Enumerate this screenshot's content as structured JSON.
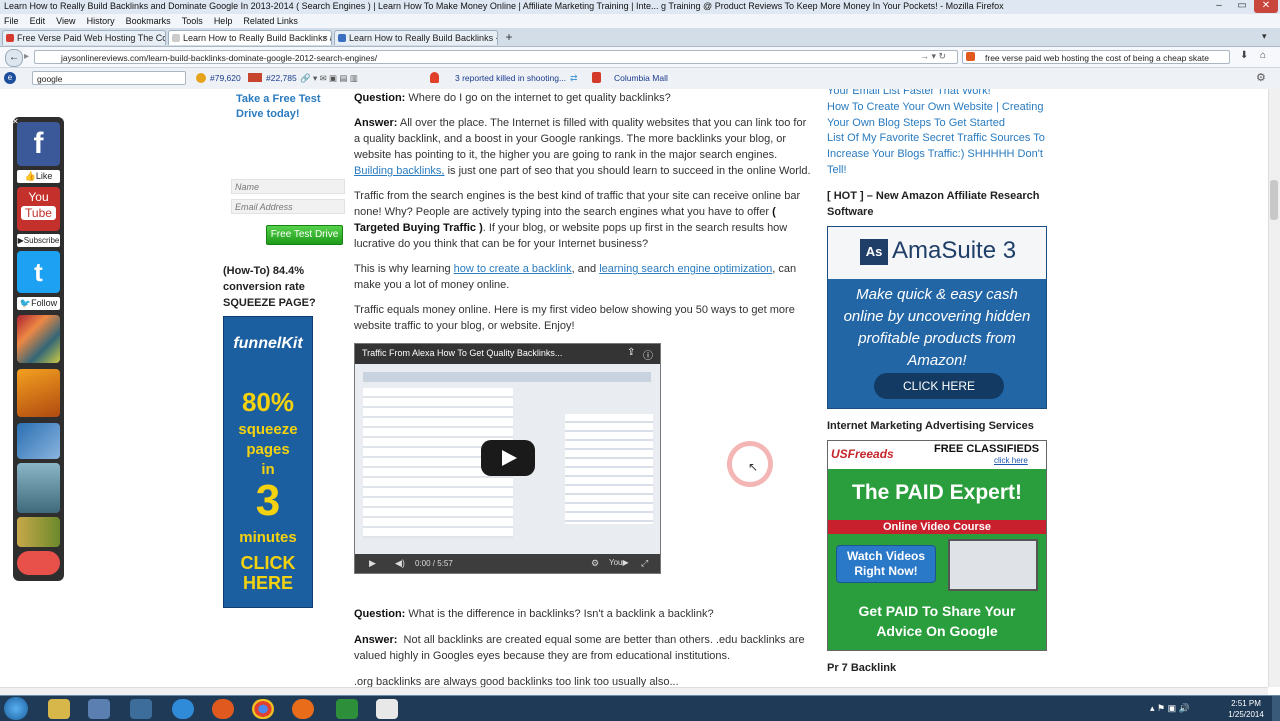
{
  "window": {
    "title": "Learn How to Really Build Backlinks and Dominate Google In 2013-2014 ( Search Engines ) | Learn How To Make Money Online | Affiliate Marketing Training | Inte... g Training @ Product Reviews To Keep More Money In Your Pockets! - Mozilla Firefox"
  },
  "menu": [
    "File",
    "Edit",
    "View",
    "History",
    "Bookmarks",
    "Tools",
    "Help",
    "Related Links"
  ],
  "tabs": [
    {
      "label": "Free Verse Paid Web Hosting The Cos...",
      "active": false
    },
    {
      "label": "Learn How to Really Build Backlinks a...",
      "active": true
    },
    {
      "label": "Learn How to Really Build Backlinks - ...",
      "active": false
    }
  ],
  "nav": {
    "url": "jaysonlinereviews.com/learn-build-backlinks-dominate-google-2012-search-engines/",
    "search": "free verse paid web hosting the cost of being a cheap skate"
  },
  "toolbar": {
    "search_value": "google",
    "alexa_rank": "#79,620",
    "us_rank": "#22,785",
    "news": "3 reported killed in shooting...",
    "mall": "Columbia Mall"
  },
  "left_sidebar": {
    "cta": "Take a Free Test Drive today!",
    "name_placeholder": "Name",
    "email_placeholder": "Email Address",
    "button": "Free Test Drive",
    "squeeze_title": "(How-To) 84.4% conversion rate SQUEEZE PAGE?",
    "funnelkit": {
      "brand": "funnelKit",
      "line1": "80%",
      "line2": "squeeze",
      "line3": "pages",
      "line4": "in",
      "line5": "3",
      "line6": "minutes",
      "cta": "CLICK HERE"
    }
  },
  "social": {
    "like": "Like",
    "subscribe": "Subscribe",
    "follow": "Follow",
    "youtube_top": "You",
    "youtube_bottom": "Tube",
    "facebook": "f",
    "twitter": "t"
  },
  "article": {
    "q1_label": "Question:",
    "q1_text": "Where do I go on the internet to get quality backlinks?",
    "a1_label": "Answer:",
    "a1_text": "All over the place. The Internet is filled with quality websites that you can link too for a quality backlink, and a boost in your Google rankings. The more backlinks your blog, or website has pointing to it, the higher you are going to rank in the major search engines.",
    "a1_link": "Building backlinks,",
    "a1_tail": "is just one part of seo that you should learn to succeed in the online World.",
    "p2_text": "Traffic from the search engines is the best kind of traffic that your site can receive online bar none! Why? People are actively typing into the search engines what you have to offer",
    "p2_bold": "( Targeted Buying Traffic )",
    "p2_tail": ". If your blog, or website pops up first in the search results how lucrative do you think that can be for your Internet business?",
    "p3_pre": "This is why learning",
    "p3_link1": "how to create a backlink",
    "p3_mid": ", and",
    "p3_link2": "learning search engine optimization",
    "p3_tail": ", can make you a lot of money online.",
    "p4_text": "Traffic equals money online. Here is my first video below showing you 50 ways to get more website traffic to your blog, or website. Enjoy!",
    "video_title": "Traffic From Alexa How To Get Quality Backlinks...",
    "video_time": "0:00 / 5:57",
    "q2_label": "Question:",
    "q2_text": "What is the difference in backlinks? Isn't a backlink a backlink?",
    "a2_label": "Answer:",
    "a2_text": "Not all backlinks are created equal some are better than others. .edu backlinks are valued highly in Googles eyes because they are from educational institutions.",
    "p5_text": ".org backlinks are always good backlinks too link too usually also..."
  },
  "right_sidebar": {
    "links": [
      "Your Email List Faster That Work!",
      "How To Create Your Own Website | Creating Your Own Blog Steps To Get Started",
      "List Of My Favorite Secret Traffic Sources To Increase Your Blogs Traffic:) SHHHHH Don't Tell!"
    ],
    "hot_heading": "[ HOT ] – New Amazon Affiliate Research Software",
    "amasuite": {
      "logo": "As",
      "name": "AmaSuite 3",
      "text": "Make quick & easy cash online by uncovering hidden profitable products from Amazon!",
      "cta": "CLICK HERE"
    },
    "ima_heading": "Internet Marketing Advertising Services",
    "usfreeads": {
      "logo": "USFreeads",
      "free": "FREE CLASSIFIEDS",
      "click": "click here",
      "paid": "The PAID Expert!",
      "course": "Online Video Course",
      "watch": "Watch Videos Right Now!",
      "bottom": "Get PAID To Share Your Advice On Google"
    },
    "pr7": "Pr 7 Backlink"
  },
  "taskbar": {
    "time": "2:51 PM",
    "date": "1/25/2014"
  }
}
